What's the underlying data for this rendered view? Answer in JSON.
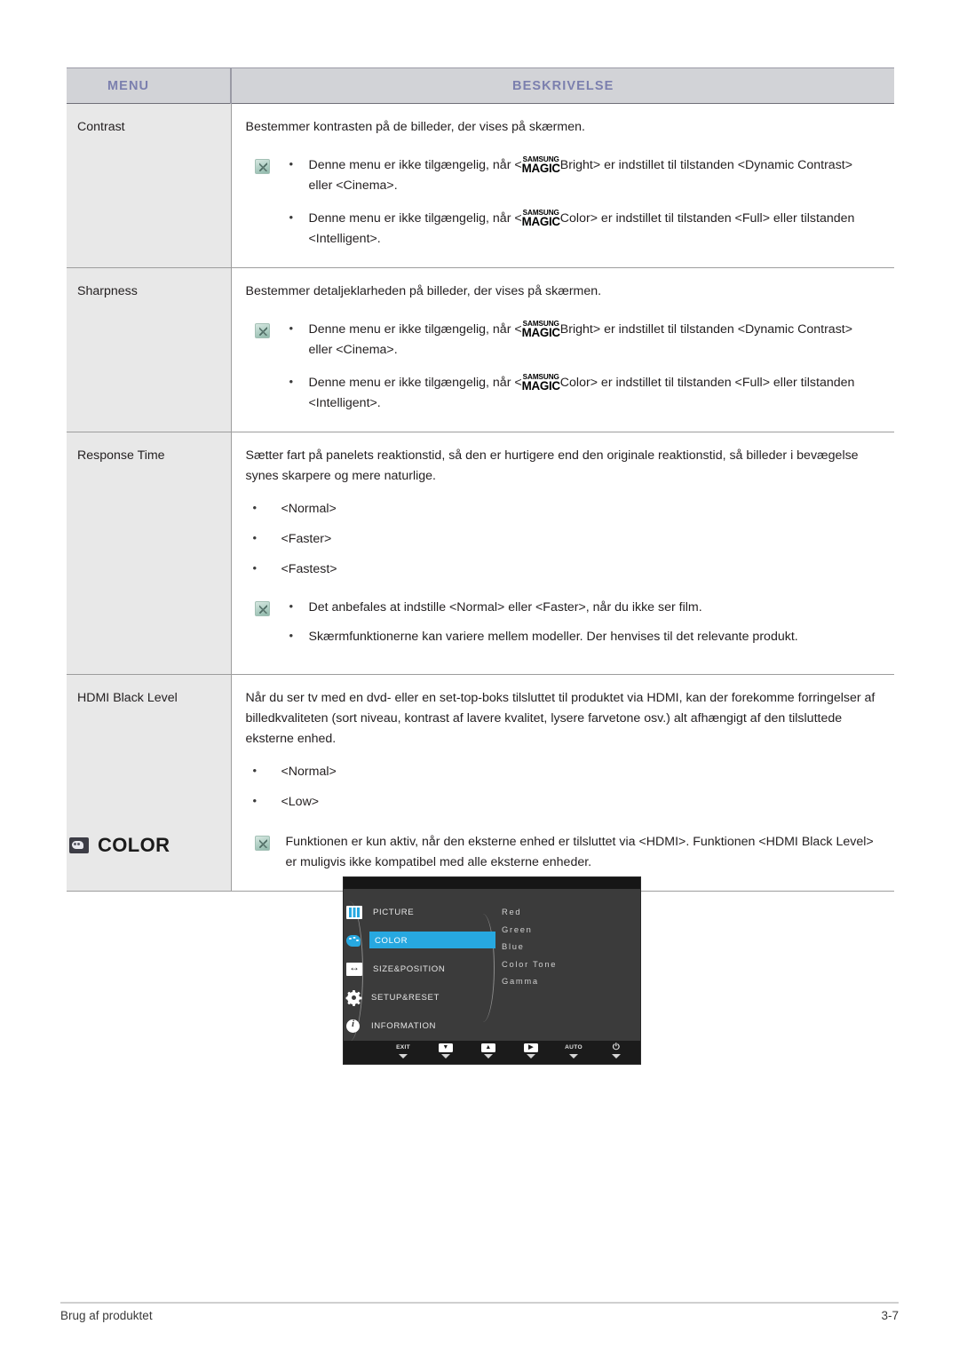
{
  "table": {
    "headers": {
      "menu": "MENU",
      "description": "BESKRIVELSE"
    },
    "rows": [
      {
        "menu": "Contrast",
        "intro": "Bestemmer kontrasten på de billeder, der vises på skærmen.",
        "notes": [
          "Denne menu er ikke tilgængelig, når <",
          "Denne menu er ikke tilgængelig, når <"
        ],
        "note1_a": "Denne menu er ikke tilgængelig, når <",
        "note1_b": "Bright> er indstillet til tilstanden <Dynamic Contrast> eller <Cinema>.",
        "note2_a": "Denne menu er ikke tilgængelig, når <",
        "note2_b": "Color> er indstillet til tilstanden <Full> eller tilstanden <Intelligent>."
      },
      {
        "menu": "Sharpness",
        "intro": "Bestemmer detaljeklarheden på billeder, der vises på skærmen.",
        "note1_a": "Denne menu er ikke tilgængelig, når <",
        "note1_b": "Bright> er indstillet til tilstanden <Dynamic Contrast> eller <Cinema>.",
        "note2_a": "Denne menu er ikke tilgængelig, når <",
        "note2_b": "Color> er indstillet til tilstanden <Full> eller tilstanden <Intelligent>."
      },
      {
        "menu": "Response Time",
        "intro": "Sætter fart på panelets reaktionstid, så den er hurtigere end den originale reaktionstid, så billeder i bevægelse synes skarpere og mere naturlige.",
        "options": [
          "<Normal>",
          "<Faster>",
          "<Fastest>"
        ],
        "note1": "Det anbefales at indstille <Normal> eller <Faster>, når du ikke ser film.",
        "note2": "Skærmfunktionerne kan variere mellem modeller. Der henvises til det relevante produkt."
      },
      {
        "menu": "HDMI Black Level",
        "intro": "Når du ser tv med en dvd- eller en set-top-boks tilsluttet til produktet via HDMI, kan der forekomme forringelser af billedkvaliteten (sort niveau, kontrast af lavere kvalitet, lysere farvetone osv.) alt afhængigt af den tilsluttede eksterne enhed.",
        "options": [
          "<Normal>",
          "<Low>"
        ],
        "note1": "Funktionen er kun aktiv, når den eksterne enhed er tilsluttet via <HDMI>. Funktionen <HDMI Black Level> er muligvis ikke kompatibel med alle eksterne enheder."
      }
    ]
  },
  "magic": {
    "top": "SAMSUNG",
    "bottom": "MAGIC"
  },
  "section": {
    "title": "COLOR"
  },
  "osd": {
    "menu_items": [
      {
        "label": "PICTURE",
        "selected": false
      },
      {
        "label": "COLOR",
        "selected": true
      },
      {
        "label": "SIZE&POSITION",
        "selected": false
      },
      {
        "label": "SETUP&RESET",
        "selected": false
      },
      {
        "label": "INFORMATION",
        "selected": false
      }
    ],
    "options": [
      "Red",
      "Green",
      "Blue",
      "Color Tone",
      "Gamma"
    ],
    "buttons": [
      {
        "label": "EXIT",
        "type": "text"
      },
      {
        "label": "▼",
        "type": "key"
      },
      {
        "label": "▲",
        "type": "key"
      },
      {
        "label": "▶",
        "type": "key"
      },
      {
        "label": "AUTO",
        "type": "text"
      },
      {
        "label": "⏻",
        "type": "power"
      }
    ],
    "highlight_color": "#27a8e0"
  },
  "footer": {
    "left": "Brug af produktet",
    "right": "3-7"
  }
}
